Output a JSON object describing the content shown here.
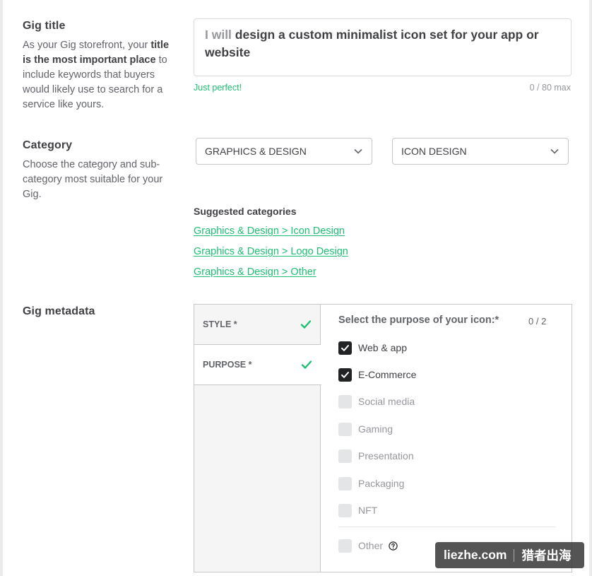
{
  "gig_title": {
    "heading": "Gig title",
    "desc_1": "As your Gig storefront, your ",
    "desc_bold": "title is the most important place",
    "desc_2": " to include keywords that buyers would likely use to search for a service like yours.",
    "prefix": "I will",
    "value": " design a custom minimalist icon set for your app or website",
    "status": "Just perfect!",
    "counter": "0 / 80 max"
  },
  "category": {
    "heading": "Category",
    "desc": "Choose the category and sub-category most suitable for your Gig.",
    "main_select": "GRAPHICS & DESIGN",
    "sub_select": "ICON DESIGN",
    "suggested_title": "Suggested categories",
    "suggested": [
      "Graphics & Design > Icon Design",
      "Graphics & Design > Logo Design",
      "Graphics & Design > Other"
    ]
  },
  "metadata": {
    "heading": "Gig metadata",
    "tabs": [
      {
        "label": "STYLE *"
      },
      {
        "label": "PURPOSE *"
      }
    ],
    "question": "Select the purpose of your icon:*",
    "count": "0 / 2",
    "options": [
      {
        "label": "Web & app",
        "state": "checked"
      },
      {
        "label": "E-Commerce",
        "state": "checked"
      },
      {
        "label": "Social media",
        "state": "disabled"
      },
      {
        "label": "Gaming",
        "state": "disabled"
      },
      {
        "label": "Presentation",
        "state": "disabled"
      },
      {
        "label": "Packaging",
        "state": "disabled"
      },
      {
        "label": "NFT",
        "state": "disabled"
      },
      {
        "label": "Other",
        "state": "disabled"
      }
    ]
  },
  "colors": {
    "accent_green": "#1dbf73",
    "text_dark": "#404145",
    "text_muted": "#62646a",
    "checkbox_checked": "#222325",
    "checkbox_disabled": "#e4e5e7"
  },
  "watermark": {
    "site": "liezhe.com",
    "brand": "猎者出海"
  }
}
